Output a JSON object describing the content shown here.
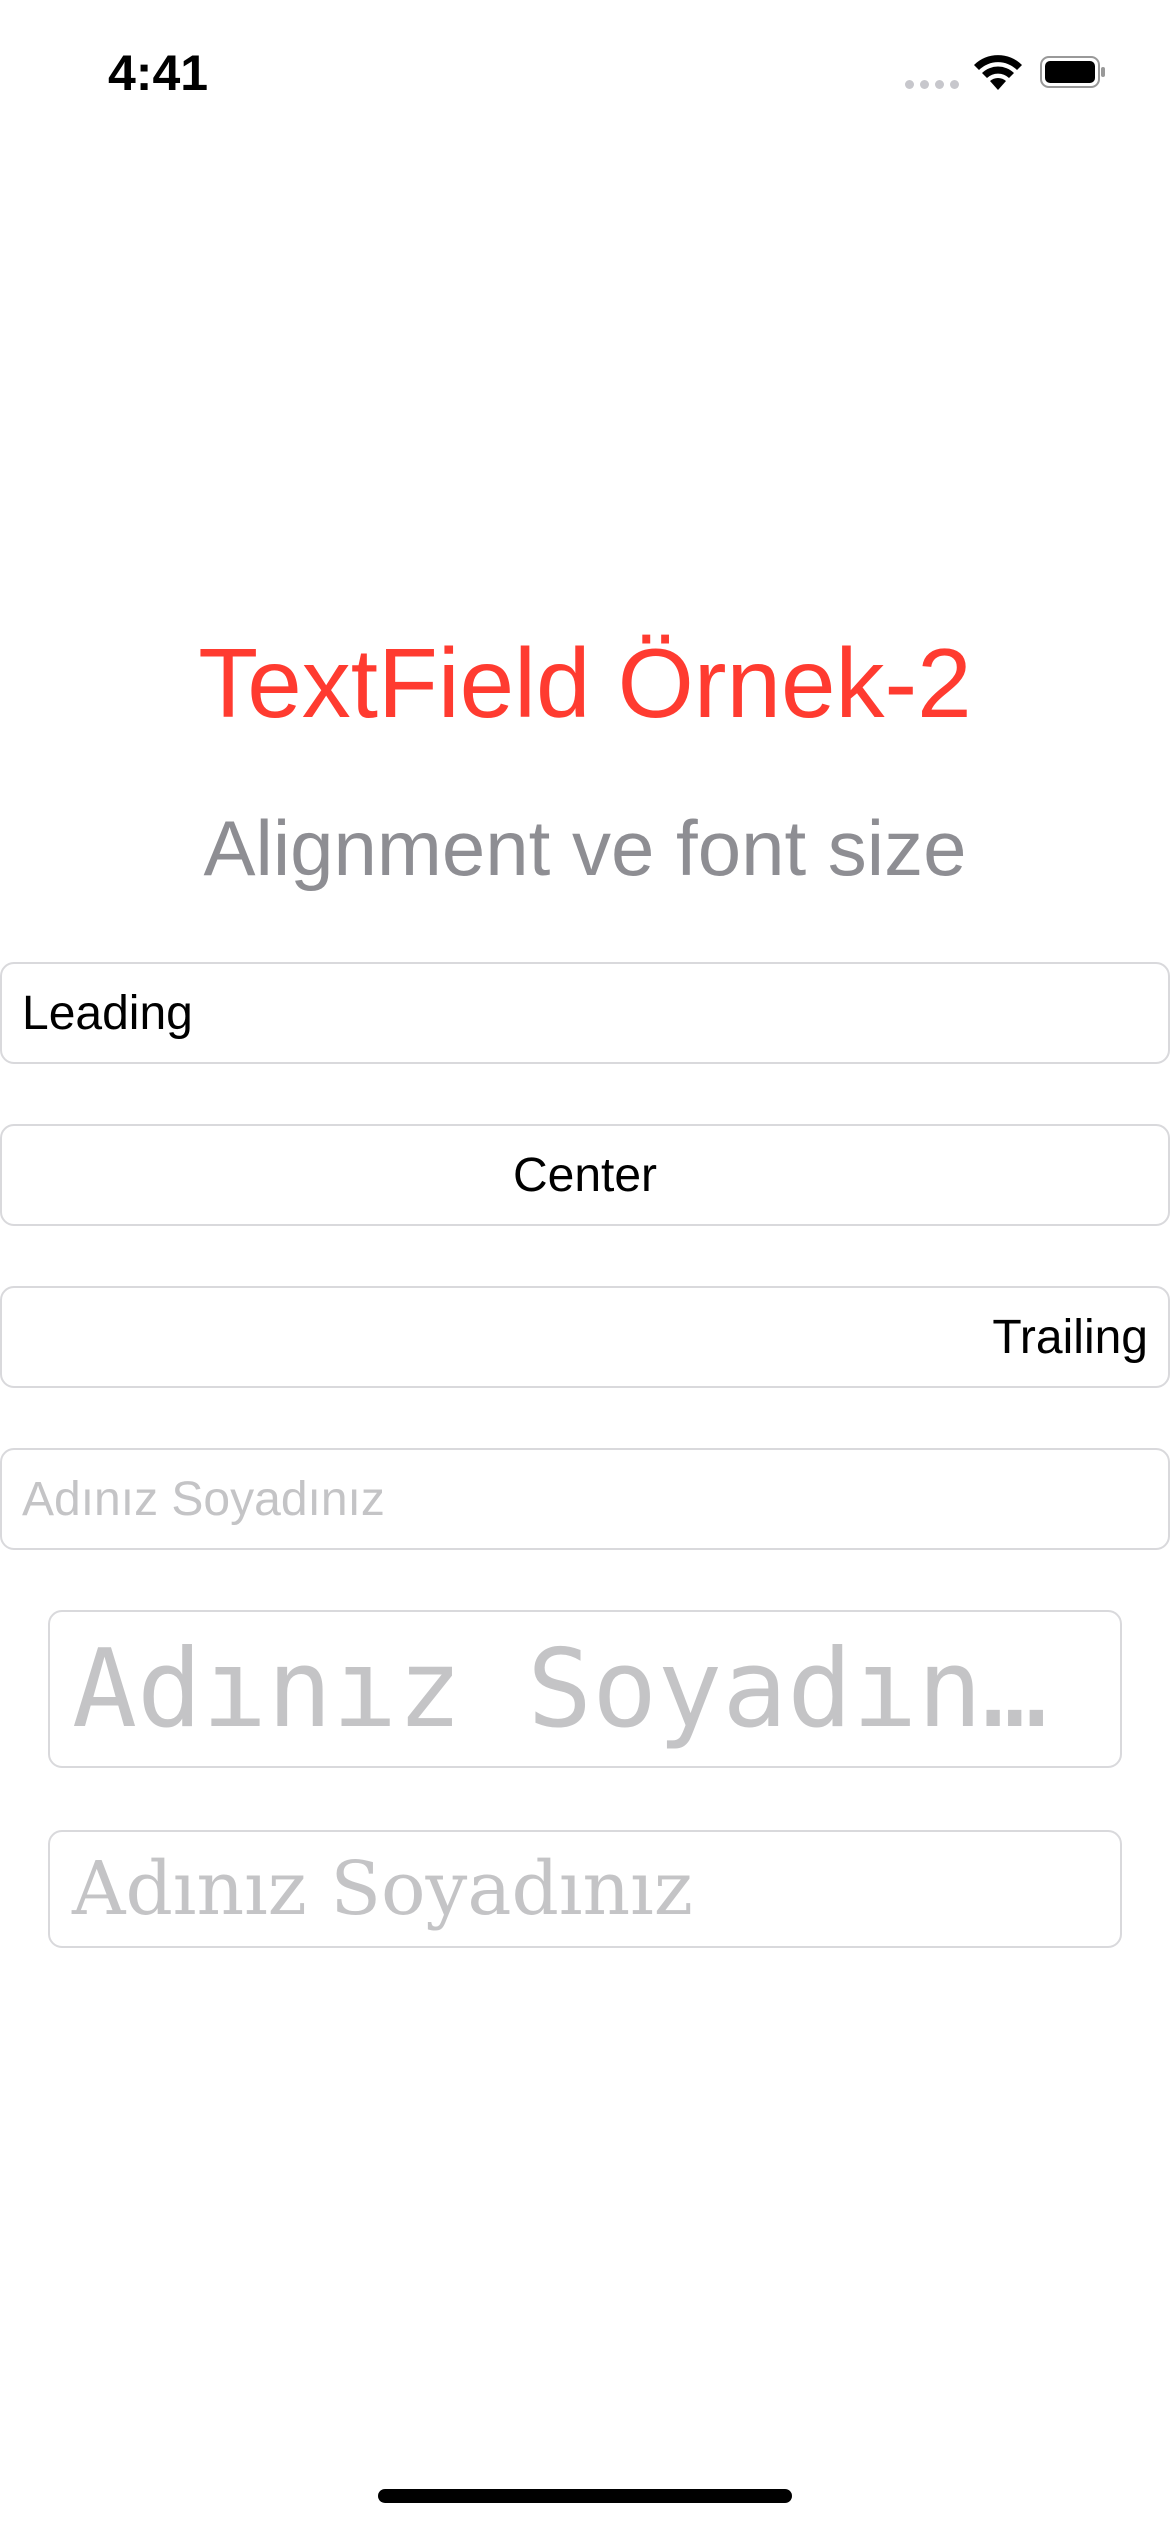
{
  "status_bar": {
    "time": "4:41",
    "icons": [
      "cellular-signal-icon",
      "wifi-icon",
      "battery-icon"
    ]
  },
  "title": "TextField Örnek-2",
  "subtitle": "Alignment ve font size",
  "fields": [
    {
      "value": "Leading",
      "placeholder": "",
      "alignment": "leading"
    },
    {
      "value": "Center",
      "placeholder": "",
      "alignment": "center"
    },
    {
      "value": "Trailing",
      "placeholder": "",
      "alignment": "trailing"
    },
    {
      "value": "",
      "placeholder": "Adınız Soyadınız",
      "alignment": "leading"
    },
    {
      "value": "",
      "placeholder": "Adınız Soyadın…",
      "alignment": "leading",
      "font": "monospace"
    },
    {
      "value": "",
      "placeholder": "Adınız Soyadınız",
      "alignment": "leading",
      "font": "serif"
    }
  ],
  "colors": {
    "title": "#ff3b30",
    "subtitle": "#8e8e93",
    "placeholder": "#c4c4c6",
    "field_border": "#d9d9dc"
  }
}
